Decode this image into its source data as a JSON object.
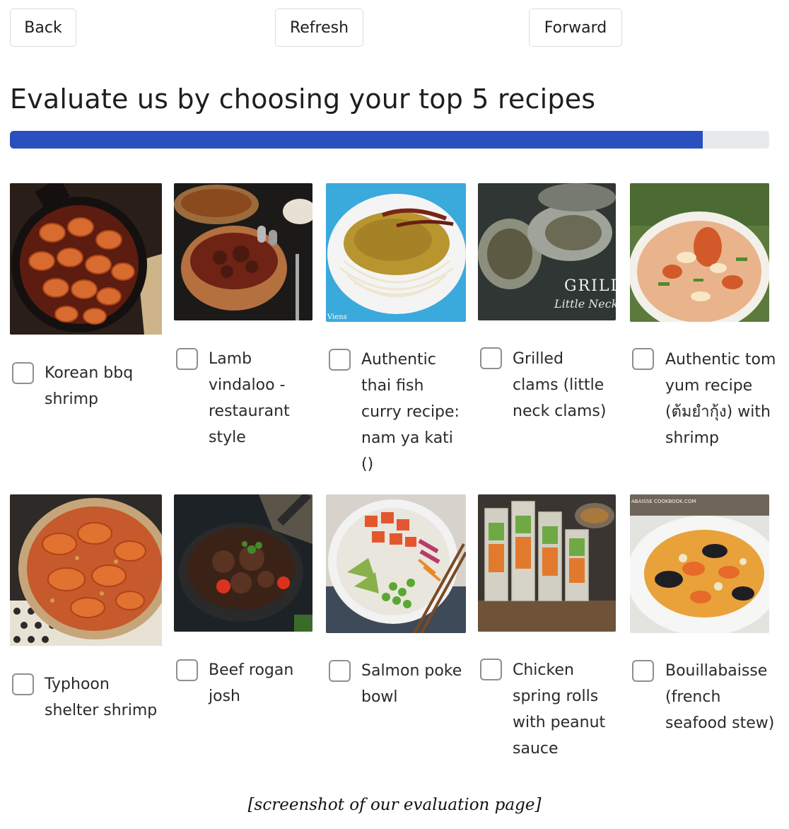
{
  "nav": {
    "back": "Back",
    "refresh": "Refresh",
    "forward": "Forward"
  },
  "title": "Evaluate us by choosing your top 5 recipes",
  "progress": {
    "fraction": 0.9125
  },
  "recipes": [
    {
      "name": "Korean bbq shrimp",
      "image": "shrimp-skillet-photo",
      "checked": false
    },
    {
      "name": "Lamb vindaloo - restaurant style",
      "image": "curry-pots-photo",
      "checked": false
    },
    {
      "name": "Authentic thai fish curry recipe: nam ya kati ()",
      "image": "noodle-curry-photo",
      "checked": false
    },
    {
      "name": "Grilled clams (little neck clams)",
      "image": "grilled-clams-photo",
      "checked": false
    },
    {
      "name": "Authentic tom yum recipe (ต้มยำกุ้ง) with shrimp",
      "image": "tom-yum-photo",
      "checked": false
    },
    {
      "name": "Typhoon shelter shrimp",
      "image": "fried-shrimp-photo",
      "checked": false
    },
    {
      "name": "Beef rogan josh",
      "image": "beef-stew-photo",
      "checked": false
    },
    {
      "name": "Salmon poke bowl",
      "image": "poke-bowl-photo",
      "checked": false
    },
    {
      "name": "Chicken spring rolls with peanut sauce",
      "image": "spring-rolls-photo",
      "checked": false
    },
    {
      "name": "Bouillabaisse (french seafood stew)",
      "image": "seafood-stew-photo",
      "checked": false
    }
  ],
  "image_text": {
    "grilled_clams_watermark": "GRILLED Little Neck C",
    "fish_curry_watermark": "Viens",
    "bouillabaisse_watermark": "ABAISSE COOKBOOK.COM"
  },
  "caption": "[screenshot of our evaluation page]",
  "colors": {
    "progress": "#2a4fbe",
    "track": "#e8e9ec",
    "checkbox_border": "#8f8f8f"
  }
}
